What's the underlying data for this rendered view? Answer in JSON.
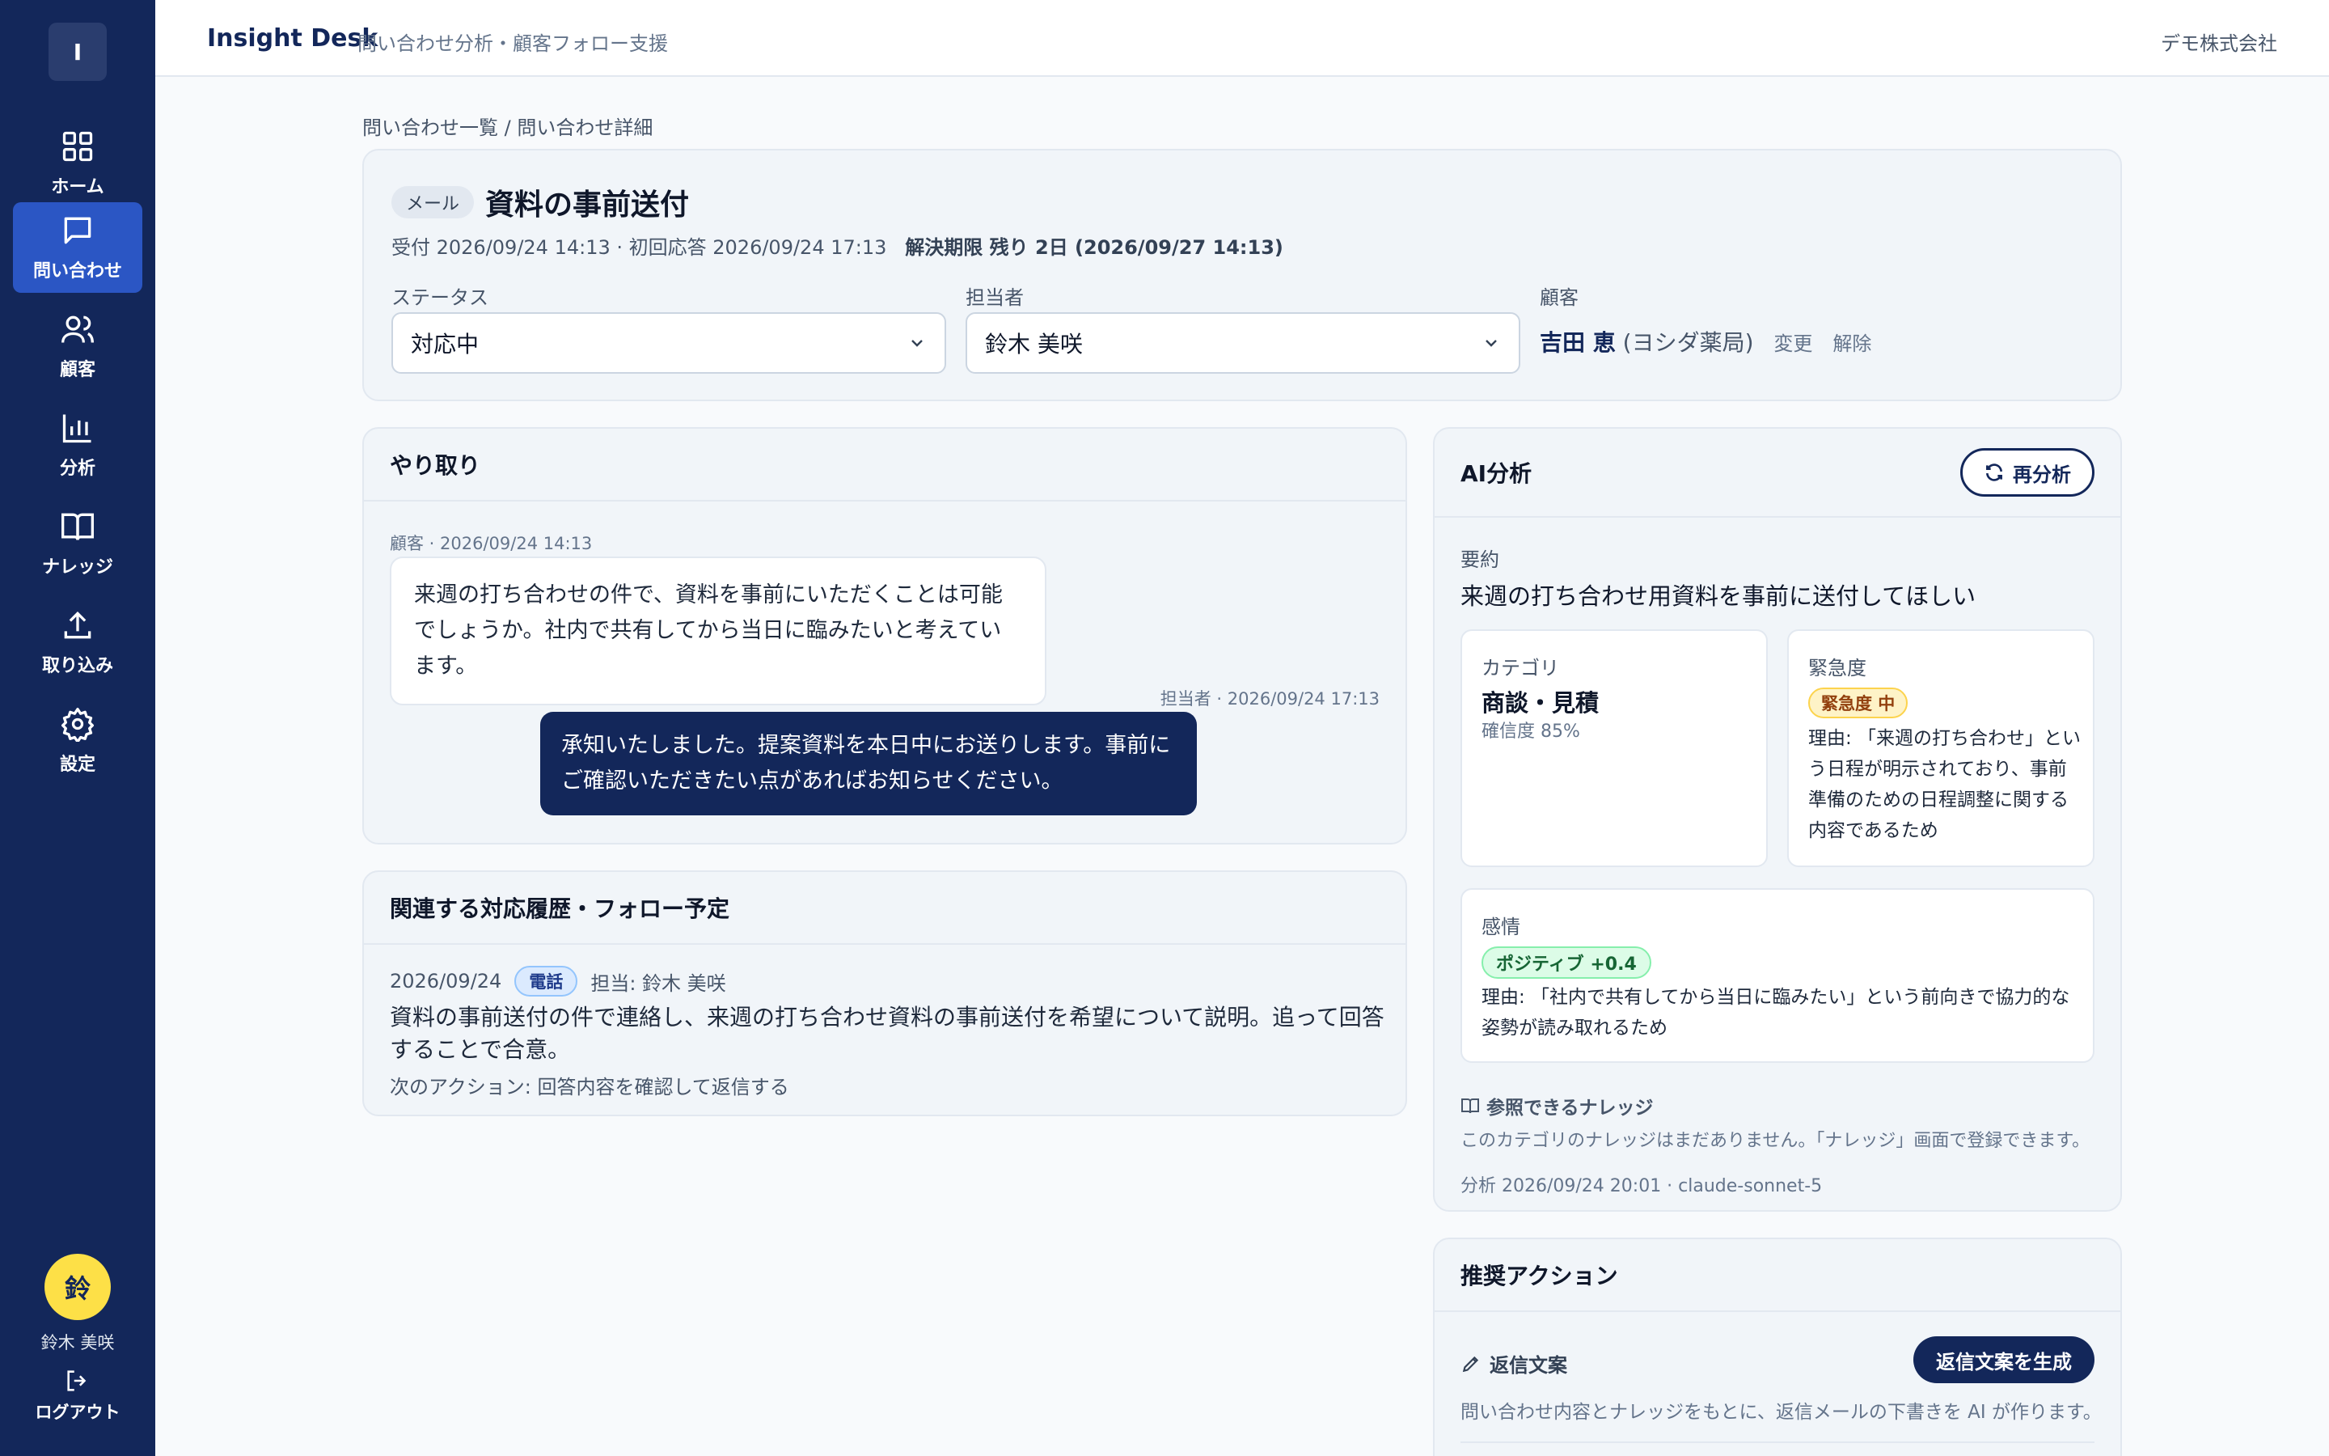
{
  "sidebar": {
    "logo": "I",
    "items": [
      {
        "label": "ホーム",
        "icon": "grid-icon"
      },
      {
        "label": "問い合わせ",
        "icon": "chat-icon"
      },
      {
        "label": "顧客",
        "icon": "users-icon"
      },
      {
        "label": "分析",
        "icon": "bar-chart-icon"
      },
      {
        "label": "ナレッジ",
        "icon": "book-icon"
      },
      {
        "label": "取り込み",
        "icon": "upload-icon"
      },
      {
        "label": "設定",
        "icon": "gear-icon"
      }
    ],
    "active_index": 1,
    "user_avatar": "鈴",
    "user_name": "鈴木 美咲",
    "logout_label": "ログアウト"
  },
  "header": {
    "brand": "Insight Desk",
    "subtitle": "問い合わせ分析・顧客フォロー支援",
    "company": "デモ株式会社"
  },
  "breadcrumb": "問い合わせ一覧 / 問い合わせ詳細",
  "inquiry": {
    "channel_tag": "メール",
    "title": "資料の事前送付",
    "meta_received": "受付 2026/09/24 14:13 · 初回応答 2026/09/24 17:13",
    "meta_deadline": "解決期限 残り 2日 (2026/09/27 14:13)",
    "status_label": "ステータス",
    "status_value": "対応中",
    "assignee_label": "担当者",
    "assignee_value": "鈴木 美咲",
    "customer_label": "顧客",
    "customer_name": "吉田 恵",
    "customer_org": "(ヨシダ薬局)",
    "customer_change": "変更",
    "customer_remove": "解除"
  },
  "conversation": {
    "title": "やり取り",
    "messages": [
      {
        "meta": "顧客 · 2026/09/24 14:13",
        "text": "来週の打ち合わせの件で、資料を事前にいただくことは可能でしょうか。社内で共有してから当日に臨みたいと考えています。"
      },
      {
        "meta": "担当者 · 2026/09/24 17:13",
        "text": "承知いたしました。提案資料を本日中にお送りします。事前にご確認いただきたい点があればお知らせください。"
      }
    ]
  },
  "history": {
    "title": "関連する対応履歴・フォロー予定",
    "date": "2026/09/24",
    "type_tag": "電話",
    "assignee": "担当: 鈴木 美咲",
    "body": "資料の事前送付の件で連絡し、来週の打ち合わせ資料の事前送付を希望について説明。追って回答することで合意。",
    "next_action": "次のアクション: 回答内容を確認して返信する"
  },
  "ai": {
    "title": "AI分析",
    "reanalyze_label": "再分析",
    "summary_label": "要約",
    "summary": "来週の打ち合わせ用資料を事前に送付してほしい",
    "category_label": "カテゴリ",
    "category_value": "商談・見積",
    "category_confidence": "確信度 85%",
    "urgency_label": "緊急度",
    "urgency_badge": "緊急度 中",
    "urgency_reason": "理由: 「来週の打ち合わせ」という日程が明示されており、事前準備のための日程調整に関する内容であるため",
    "sentiment_label": "感情",
    "sentiment_badge": "ポジティブ +0.4",
    "sentiment_reason": "理由: 「社内で共有してから当日に臨みたい」という前向きで協力的な姿勢が読み取れるため",
    "knowledge_title": "参照できるナレッジ",
    "knowledge_text": "このカテゴリのナレッジはまだありません。「ナレッジ」画面で登録できます。",
    "footer": "分析 2026/09/24 20:01 · claude-sonnet-5"
  },
  "recommend": {
    "title": "推奨アクション",
    "reply_label": "返信文案",
    "generate_button": "返信文案を生成",
    "reply_desc": "問い合わせ内容とナレッジをもとに、返信メールの下書きを AI が作ります。"
  }
}
